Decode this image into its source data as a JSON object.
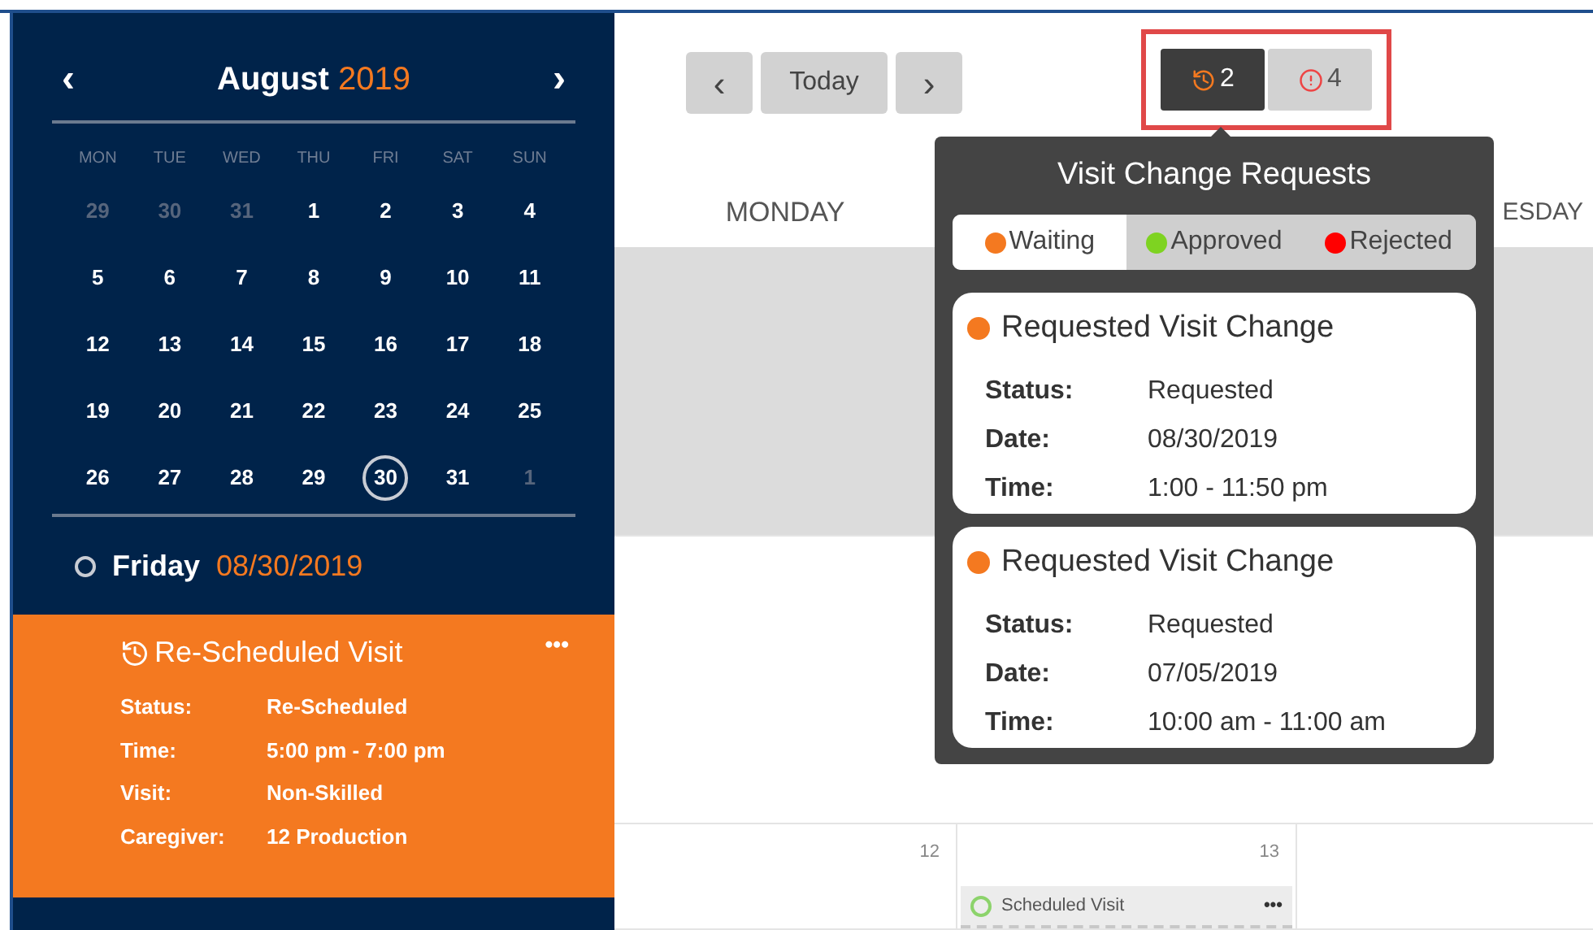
{
  "mini_calendar": {
    "month": "August",
    "year": "2019",
    "prev": "‹",
    "next": "›",
    "weekdays": [
      "MON",
      "TUE",
      "WED",
      "THU",
      "FRI",
      "SAT",
      "SUN"
    ],
    "weeks": [
      [
        {
          "label": "29",
          "muted": true,
          "selected": false
        },
        {
          "label": "30",
          "muted": true,
          "selected": false
        },
        {
          "label": "31",
          "muted": true,
          "selected": false
        },
        {
          "label": "1",
          "muted": false,
          "selected": false
        },
        {
          "label": "2",
          "muted": false,
          "selected": false
        },
        {
          "label": "3",
          "muted": false,
          "selected": false
        },
        {
          "label": "4",
          "muted": false,
          "selected": false
        }
      ],
      [
        {
          "label": "5",
          "muted": false,
          "selected": false
        },
        {
          "label": "6",
          "muted": false,
          "selected": false
        },
        {
          "label": "7",
          "muted": false,
          "selected": false
        },
        {
          "label": "8",
          "muted": false,
          "selected": false
        },
        {
          "label": "9",
          "muted": false,
          "selected": false
        },
        {
          "label": "10",
          "muted": false,
          "selected": false
        },
        {
          "label": "11",
          "muted": false,
          "selected": false
        }
      ],
      [
        {
          "label": "12",
          "muted": false,
          "selected": false
        },
        {
          "label": "13",
          "muted": false,
          "selected": false
        },
        {
          "label": "14",
          "muted": false,
          "selected": false
        },
        {
          "label": "15",
          "muted": false,
          "selected": false
        },
        {
          "label": "16",
          "muted": false,
          "selected": false
        },
        {
          "label": "17",
          "muted": false,
          "selected": false
        },
        {
          "label": "18",
          "muted": false,
          "selected": false
        }
      ],
      [
        {
          "label": "19",
          "muted": false,
          "selected": false
        },
        {
          "label": "20",
          "muted": false,
          "selected": false
        },
        {
          "label": "21",
          "muted": false,
          "selected": false
        },
        {
          "label": "22",
          "muted": false,
          "selected": false
        },
        {
          "label": "23",
          "muted": false,
          "selected": false
        },
        {
          "label": "24",
          "muted": false,
          "selected": false
        },
        {
          "label": "25",
          "muted": false,
          "selected": false
        }
      ],
      [
        {
          "label": "26",
          "muted": false,
          "selected": false
        },
        {
          "label": "27",
          "muted": false,
          "selected": false
        },
        {
          "label": "28",
          "muted": false,
          "selected": false
        },
        {
          "label": "29",
          "muted": false,
          "selected": false
        },
        {
          "label": "30",
          "muted": false,
          "selected": true
        },
        {
          "label": "31",
          "muted": false,
          "selected": false
        },
        {
          "label": "1",
          "muted": true,
          "selected": false
        }
      ]
    ]
  },
  "selected_day": {
    "weekday": "Friday",
    "date": "08/30/2019"
  },
  "visit_card": {
    "title": "Re-Scheduled Visit",
    "more": "•••",
    "fields": [
      {
        "label": "Status:",
        "value": "Re-Scheduled"
      },
      {
        "label": "Time:",
        "value": "5:00 pm - 7:00 pm"
      },
      {
        "label": "Visit:",
        "value": "Non-Skilled"
      },
      {
        "label": "Caregiver:",
        "value": "12 Production"
      }
    ]
  },
  "toolbar": {
    "prev": "‹",
    "today": "Today",
    "next": "›",
    "badges": [
      {
        "kind": "change",
        "count": "2",
        "selected": true
      },
      {
        "kind": "alert",
        "count": "4",
        "selected": false
      }
    ]
  },
  "calendar": {
    "columns": [
      {
        "header": "MONDAY"
      },
      {},
      {
        "header": "ESDAY"
      }
    ],
    "rows": [
      {
        "shaded": true,
        "cells": [
          {},
          {},
          {}
        ]
      },
      {
        "shaded": false,
        "cells": [
          {},
          {},
          {}
        ]
      },
      {
        "shaded": false,
        "cells": [
          {
            "date": "12"
          },
          {
            "date": "13",
            "event": {
              "title": "Scheduled Visit",
              "more": "•••"
            }
          },
          {}
        ]
      }
    ]
  },
  "popup": {
    "title": "Visit Change Requests",
    "tabs": [
      {
        "label": "Waiting",
        "color": "#f47920",
        "selected": true
      },
      {
        "label": "Approved",
        "color": "#7ed321",
        "selected": false
      },
      {
        "label": "Rejected",
        "color": "#ff0000",
        "selected": false
      }
    ],
    "requests": [
      {
        "title": "Requested Visit Change",
        "color": "#f47920",
        "fields": [
          {
            "label": "Status:",
            "value": "Requested"
          },
          {
            "label": "Date:",
            "value": "08/30/2019"
          },
          {
            "label": "Time:",
            "value": "1:00 - 11:50 pm"
          }
        ]
      },
      {
        "title": "Requested Visit Change",
        "color": "#f47920",
        "fields": [
          {
            "label": "Status:",
            "value": "Requested"
          },
          {
            "label": "Date:",
            "value": "07/05/2019"
          },
          {
            "label": "Time:",
            "value": "10:00 am - 11:00 am"
          }
        ]
      }
    ]
  }
}
